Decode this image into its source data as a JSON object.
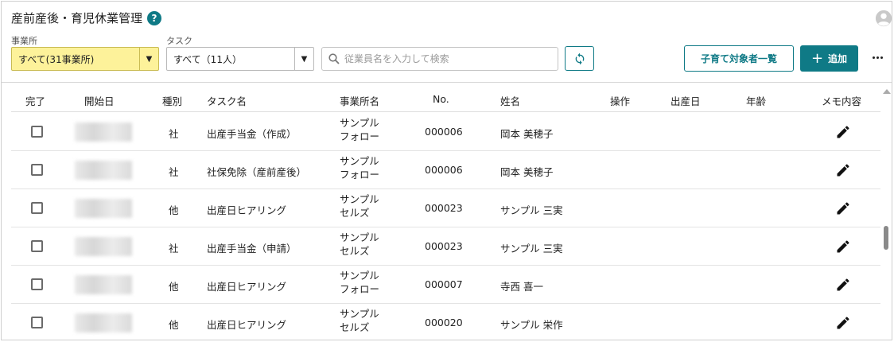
{
  "header": {
    "title": "産前産後・育児休業管理",
    "help_icon": "?"
  },
  "filters": {
    "office_label": "事業所",
    "office_value": "すべて(31事業所)",
    "task_label": "タスク",
    "task_value": "すべて（11人）",
    "search_placeholder": "従業員名を入力して検索"
  },
  "toolbar": {
    "childcare_list_label": "子育て対象者一覧",
    "add_label": "追加"
  },
  "table": {
    "headers": {
      "done": "完了",
      "start_date": "開始日",
      "type": "種別",
      "task_name": "タスク名",
      "office_name": "事業所名",
      "no": "No.",
      "full_name": "姓名",
      "operation": "操作",
      "birth_date": "出産日",
      "age": "年齢",
      "memo": "メモ内容"
    },
    "rows": [
      {
        "type": "社",
        "task": "出産手当金（作成）",
        "office1": "サンプル",
        "office2": "フォロー",
        "no": "000006",
        "name": "岡本 美穂子"
      },
      {
        "type": "社",
        "task": "社保免除（産前産後）",
        "office1": "サンプル",
        "office2": "フォロー",
        "no": "000006",
        "name": "岡本 美穂子"
      },
      {
        "type": "他",
        "task": "出産日ヒアリング",
        "office1": "サンプル",
        "office2": "セルズ",
        "no": "000023",
        "name": "サンプル 三実"
      },
      {
        "type": "社",
        "task": "出産手当金（申請）",
        "office1": "サンプル",
        "office2": "セルズ",
        "no": "000023",
        "name": "サンプル 三実"
      },
      {
        "type": "他",
        "task": "出産日ヒアリング",
        "office1": "サンプル",
        "office2": "フォロー",
        "no": "000007",
        "name": "寺西 喜一"
      },
      {
        "type": "他",
        "task": "出産日ヒアリング",
        "office1": "サンプル",
        "office2": "セルズ",
        "no": "000020",
        "name": "サンプル 栄作"
      }
    ]
  },
  "colors": {
    "accent": "#0f7a86",
    "office_select_bg": "#fdf29a"
  },
  "icons": {
    "help": "help-icon",
    "avatar": "account-circle-icon",
    "dropdown": "triangle-down-icon",
    "search": "search-icon",
    "refresh": "refresh-icon",
    "add": "plus-icon",
    "more": "more-horizontal-icon",
    "memo": "pencil-icon"
  }
}
